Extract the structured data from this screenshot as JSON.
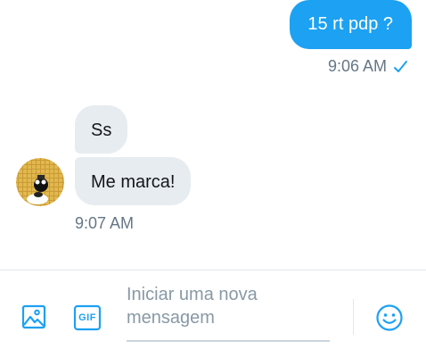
{
  "messages": {
    "outgoing": [
      {
        "text": "15 rt pdp ?",
        "time": "9:06 AM",
        "status_icon": "check-icon"
      }
    ],
    "incoming": [
      {
        "text": "Ss"
      },
      {
        "text": "Me marca!"
      }
    ],
    "incoming_time": "9:07 AM"
  },
  "composer": {
    "placeholder": "Iniciar uma nova mensagem",
    "image_icon": "image-icon",
    "gif_label": "GIF",
    "emoji_icon": "smiley-icon"
  },
  "colors": {
    "accent": "#1da1f2",
    "incoming_bubble": "#e6ecf0",
    "meta_text": "#657786"
  }
}
